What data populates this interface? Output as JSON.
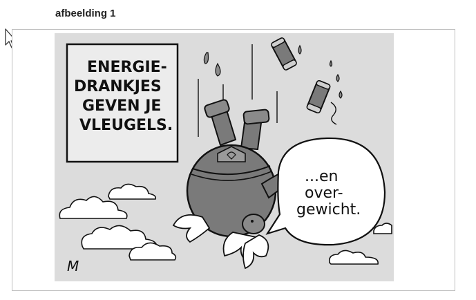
{
  "page": {
    "title": "afbeelding 1"
  },
  "cartoon": {
    "sign_lines": [
      "ENERGIE-",
      "DRANKJES",
      "GEVEN JE",
      "VLEUGELS."
    ],
    "speech_lines": [
      "...en",
      "over-",
      "gewicht."
    ],
    "signature": "M"
  },
  "icons": {
    "cursor": "arrow-cursor-icon"
  },
  "colors": {
    "background": "#dcdcdc",
    "body": "#7a7a7a",
    "outline": "#111111"
  }
}
